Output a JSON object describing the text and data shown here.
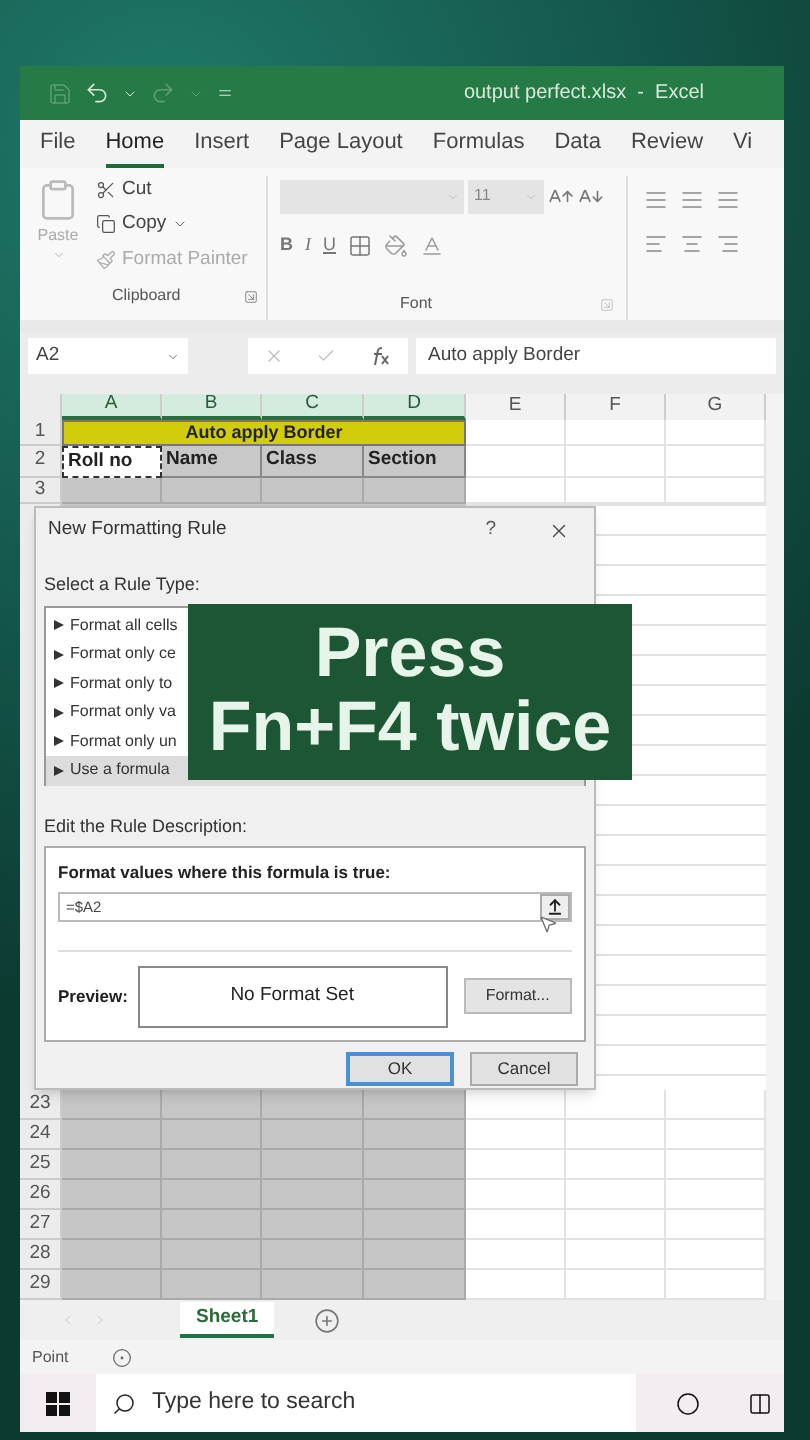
{
  "window": {
    "title": "output perfect.xlsx  -  Excel"
  },
  "ribbon_tabs": [
    {
      "label": "File",
      "selected": false
    },
    {
      "label": "Home",
      "selected": true
    },
    {
      "label": "Insert",
      "selected": false
    },
    {
      "label": "Page Layout",
      "selected": false
    },
    {
      "label": "Formulas",
      "selected": false
    },
    {
      "label": "Data",
      "selected": false
    },
    {
      "label": "Review",
      "selected": false
    },
    {
      "label": "Vi",
      "selected": false
    }
  ],
  "clipboard": {
    "paste": "Paste",
    "cut": "Cut",
    "copy": "Copy",
    "format_painter": "Format Painter",
    "label": "Clipboard"
  },
  "font": {
    "size": "11",
    "bold": "B",
    "italic": "I",
    "underline": "U",
    "label": "Font"
  },
  "formula_bar": {
    "name_box": "A2",
    "formula": "Auto apply Border"
  },
  "columns": [
    {
      "label": "A",
      "selected": true
    },
    {
      "label": "B",
      "selected": true
    },
    {
      "label": "C",
      "selected": true
    },
    {
      "label": "D",
      "selected": true
    },
    {
      "label": "E",
      "selected": false
    },
    {
      "label": "F",
      "selected": false
    },
    {
      "label": "G",
      "selected": false
    }
  ],
  "rows": [
    {
      "number": "1",
      "kind": "title",
      "text": "Auto apply Border"
    },
    {
      "number": "2",
      "kind": "header",
      "cells": [
        {
          "text": "Roll no",
          "active": true
        },
        {
          "text": "Name",
          "active": false
        },
        {
          "text": "Class",
          "active": false
        },
        {
          "text": "Section",
          "active": false
        }
      ]
    },
    {
      "number": "3",
      "kind": "empty"
    },
    {
      "number": "23",
      "kind": "empty"
    },
    {
      "number": "24",
      "kind": "empty"
    },
    {
      "number": "25",
      "kind": "empty"
    },
    {
      "number": "26",
      "kind": "empty"
    },
    {
      "number": "27",
      "kind": "empty"
    },
    {
      "number": "28",
      "kind": "empty"
    },
    {
      "number": "29",
      "kind": "empty"
    }
  ],
  "dialog": {
    "title": "New Formatting Rule",
    "help": "?",
    "select_label": "Select a Rule Type:",
    "rule_types": [
      {
        "label": "Format all cells",
        "selected": false
      },
      {
        "label": "Format only ce",
        "selected": false
      },
      {
        "label": "Format only to",
        "selected": false
      },
      {
        "label": "Format only va",
        "selected": false
      },
      {
        "label": "Format only un",
        "selected": false
      },
      {
        "label": "Use a formula",
        "selected": true
      }
    ],
    "edit_label": "Edit the Rule Description:",
    "formula_label": "Format values where this formula is true:",
    "formula_value": "=$A2",
    "preview_label": "Preview:",
    "preview_text": "No Format Set",
    "format_button": "Format...",
    "ok": "OK",
    "cancel": "Cancel"
  },
  "caption": {
    "lines": [
      "Press",
      "Fn+F4 twice"
    ]
  },
  "sheet_tabs": [
    {
      "label": "Sheet1",
      "selected": true
    }
  ],
  "status": "Point",
  "taskbar": {
    "search_placeholder": "Type here to search"
  }
}
